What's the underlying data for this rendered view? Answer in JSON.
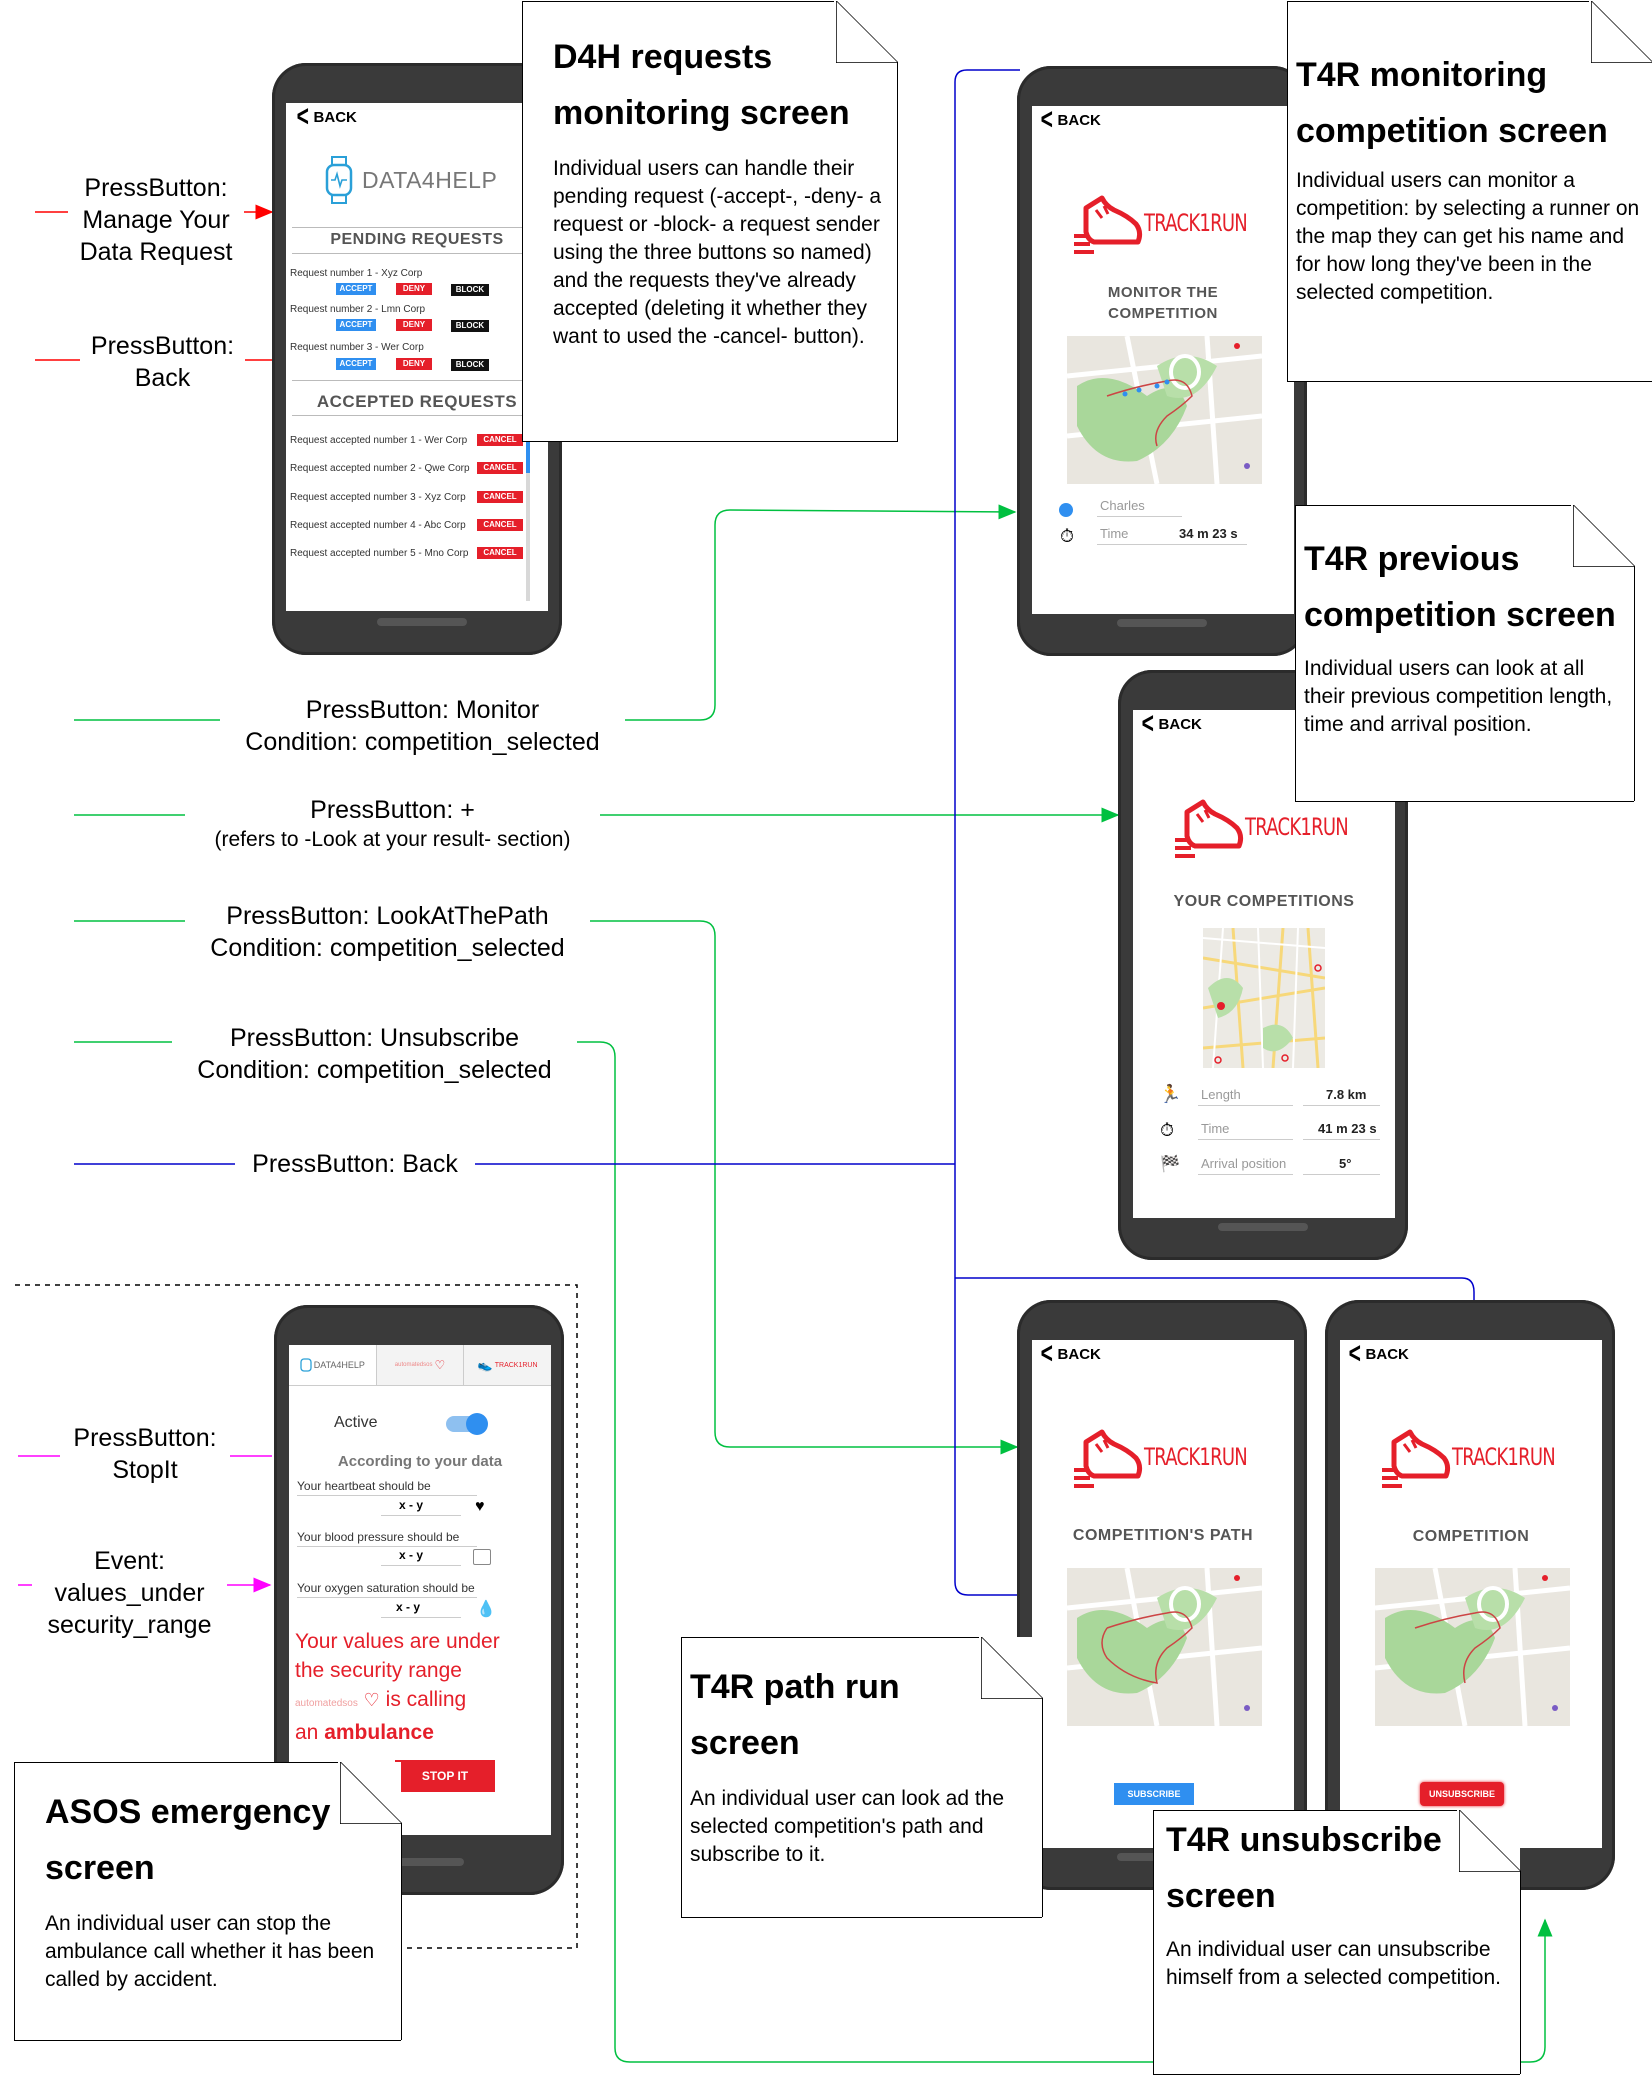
{
  "notes": {
    "d4h": {
      "title_line1": "D4H requests",
      "title_line2": "monitoring screen",
      "body": "Individual users can handle their pending request (-accept-, -deny- a request or -block- a request sender using the three buttons so named) and the requests they've already accepted (deleting it whether they want to used the -cancel- button)."
    },
    "t4r_monitoring": {
      "title_line1": "T4R monitoring",
      "title_line2": "competition screen",
      "body": "Individual users can monitor a competition: by selecting a runner on the map they can get his name and for how long they've been in the selected competition."
    },
    "t4r_previous": {
      "title_line1": "T4R previous",
      "title_line2": "competition screen",
      "body": "Individual users can look at all their previous competition length, time and arrival position."
    },
    "t4r_path": {
      "title_line1": "T4R path run",
      "title_line2": "screen",
      "body": "An individual user can look ad the selected competition's path and subscribe to it."
    },
    "t4r_unsubscribe": {
      "title_line1": "T4R unsubscribe",
      "title_line2": "screen",
      "body": "An individual user can unsubscribe himself from a selected competition."
    },
    "asos": {
      "title_line1": "ASOS emergency",
      "title_line2": "screen",
      "body": "An individual user can stop the ambulance call whether it has been called by accident."
    }
  },
  "transitions": {
    "manage": "PressButton:\nManage Your\nData Request",
    "back_d4h": "PressButton:\nBack",
    "monitor": "PressButton: Monitor\nCondition: competition_selected",
    "plus_line1": "PressButton: +",
    "plus_line2": "(refers to -Look at your result- section)",
    "lookpath": "PressButton: LookAtThePath\nCondition: competition_selected",
    "unsubscribe": "PressButton: Unsubscribe\nCondition: competition_selected",
    "back_main": "PressButton: Back",
    "stopit": "PressButton:\nStopIt",
    "event": "Event:\nvalues_under\nsecurity_range"
  },
  "d4h_screen": {
    "back": "BACK",
    "logo": "DATA4HELP",
    "pending_title": "PENDING REQUESTS",
    "pending": [
      "Request number 1 - Xyz Corp",
      "Request number 2 - Lmn Corp",
      "Request number 3 - Wer Corp"
    ],
    "accept": "ACCEPT",
    "deny": "DENY",
    "block": "BLOCK",
    "accepted_title": "ACCEPTED REQUESTS",
    "accepted": [
      "Request accepted number 1 - Wer Corp",
      "Request accepted number 2 - Qwe Corp",
      "Request accepted number 3 - Xyz Corp",
      "Request accepted number 4 - Abc Corp",
      "Request accepted number 5 - Mno Corp"
    ],
    "cancel": "CANCEL"
  },
  "monitor_screen": {
    "back": "BACK",
    "logo": "TRACK1RUN",
    "title_line1": "MONITOR THE",
    "title_line2": "COMPETITION",
    "runner": "Charles",
    "time_label": "Time",
    "time_value": "34 m 23 s"
  },
  "previous_screen": {
    "back": "BACK",
    "logo": "TRACK1RUN",
    "title": "YOUR COMPETITIONS",
    "length_label": "Length",
    "length_value": "7.8 km",
    "time_label": "Time",
    "time_value": "41 m 23 s",
    "arrival_label": "Arrival position",
    "arrival_value": "5°"
  },
  "path_screen": {
    "back": "BACK",
    "logo": "TRACK1RUN",
    "title": "COMPETITION'S PATH",
    "button": "SUBSCRIBE"
  },
  "unsub_screen": {
    "back": "BACK",
    "logo": "TRACK1RUN",
    "title": "COMPETITION",
    "button": "UNSUBSCRIBE"
  },
  "asos_screen": {
    "tab_d4h": "DATA4HELP",
    "tab_asos": "automatedsos",
    "tab_t4r": "TRACK1RUN",
    "active": "Active",
    "subtitle": "According to your data",
    "heartbeat": "Your heartbeat should be",
    "pressure": "Your blood pressure should be",
    "oxygen": "Your oxygen saturation should be",
    "range": "x - y",
    "alert_line1": "Your values are under",
    "alert_line2": "the security range",
    "alert_brand": "automatedsos",
    "alert_calling": "is calling",
    "alert_an": "an",
    "alert_ambulance": "ambulance",
    "stop": "STOP IT"
  },
  "colors": {
    "red": "#ff0000",
    "green": "#00c040",
    "blue": "#0000cc",
    "magenta": "#ff00ff",
    "brand_red": "#e51f2a",
    "accept_blue": "#2f8ff0"
  }
}
